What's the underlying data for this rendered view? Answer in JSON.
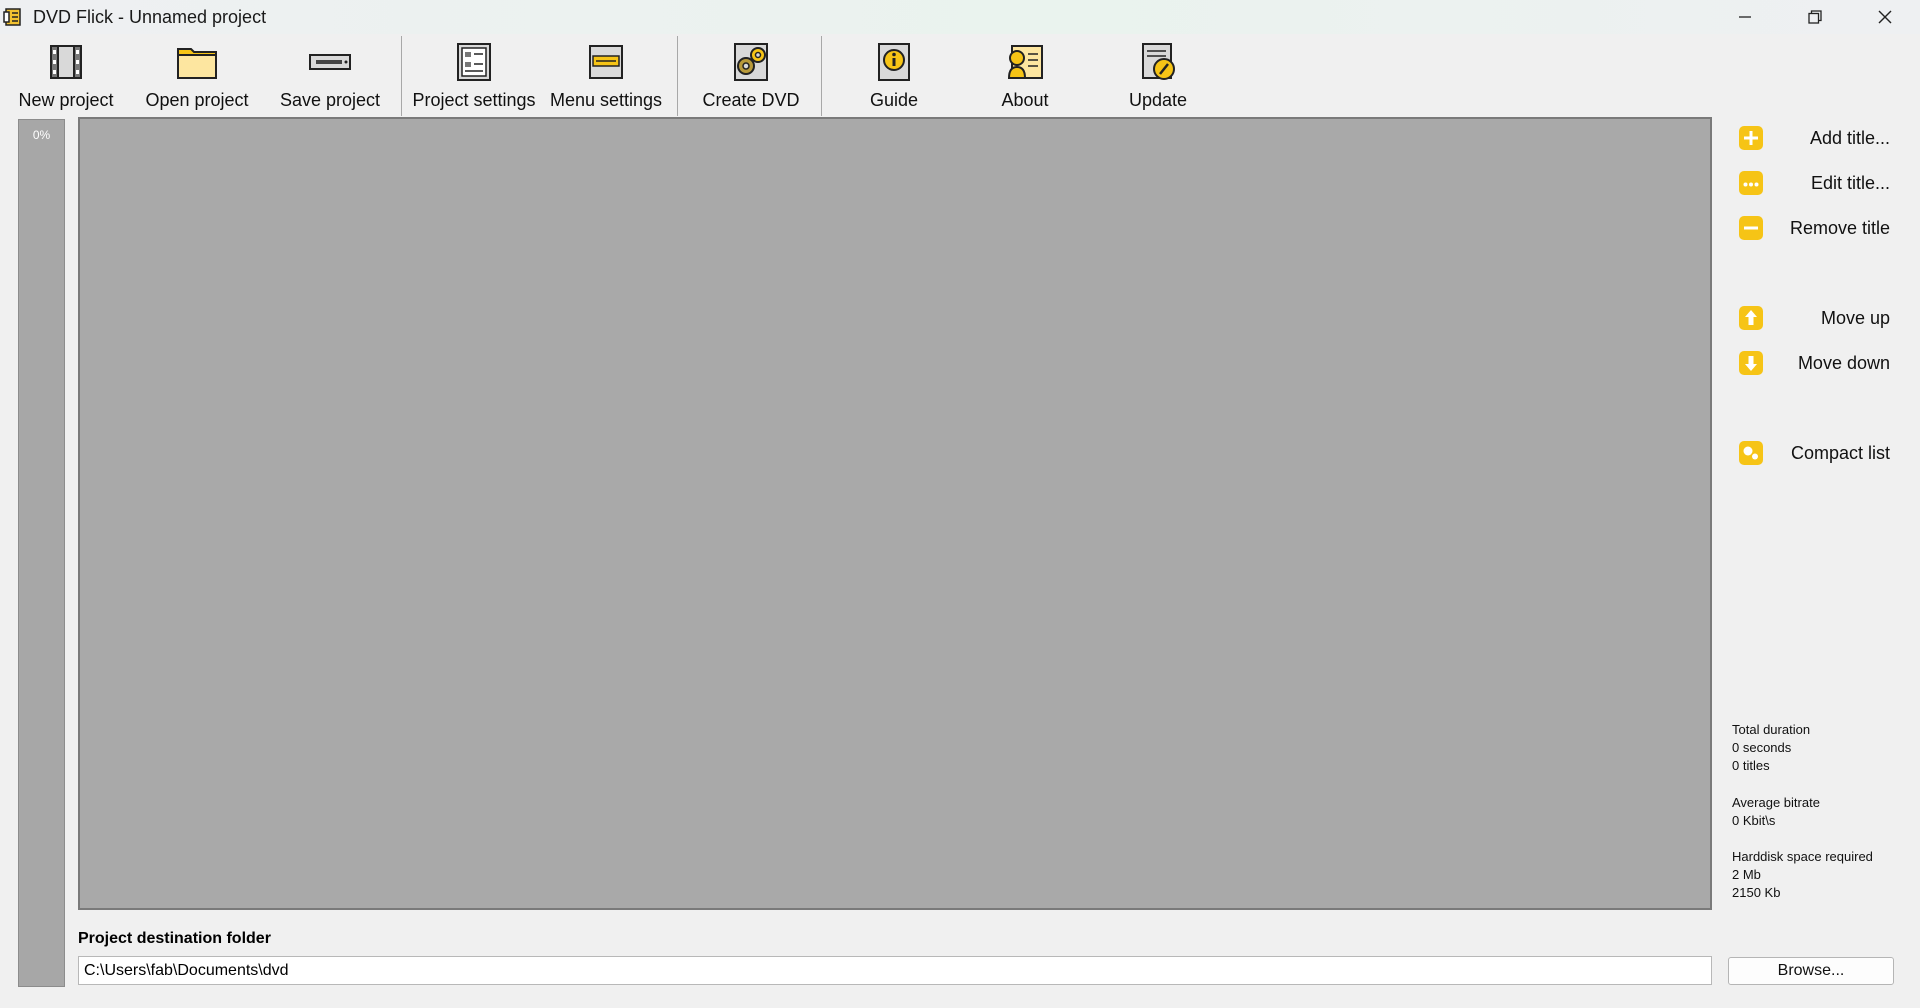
{
  "window": {
    "title": "DVD Flick - Unnamed project"
  },
  "toolbar": {
    "new_project": "New project",
    "open_project": "Open project",
    "save_project": "Save project",
    "project_settings": "Project settings",
    "menu_settings": "Menu settings",
    "create_dvd": "Create DVD",
    "guide": "Guide",
    "about": "About",
    "update": "Update"
  },
  "progress": {
    "percent_label": "0%",
    "value": 0
  },
  "side_buttons": {
    "add_title": "Add title...",
    "edit_title": "Edit title...",
    "remove_title": "Remove title",
    "move_up": "Move up",
    "move_down": "Move down",
    "compact_list": "Compact list"
  },
  "stats": {
    "total_duration_label": "Total duration",
    "duration_value": "0 seconds",
    "titles_value": "0 titles",
    "avg_bitrate_label": "Average bitrate",
    "avg_bitrate_value": "0 Kbit\\s",
    "harddisk_label": "Harddisk space required",
    "harddisk_mb": "2 Mb",
    "harddisk_kb": "2150 Kb"
  },
  "destination": {
    "label": "Project destination folder",
    "path": "C:\\Users\\fab\\Documents\\dvd",
    "browse_label": "Browse..."
  },
  "colors": {
    "accent_yellow": "#f6c416",
    "list_background": "#a9a9a9",
    "window_background": "#f0f0f0"
  }
}
